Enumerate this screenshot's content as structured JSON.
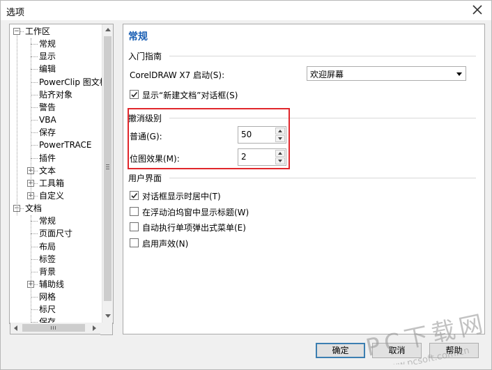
{
  "dialog": {
    "title": "选项"
  },
  "tree": {
    "items": [
      {
        "label": "工作区",
        "level": 0,
        "expander": "⊟"
      },
      {
        "label": "常规",
        "level": 1
      },
      {
        "label": "显示",
        "level": 1
      },
      {
        "label": "编辑",
        "level": 1
      },
      {
        "label": "PowerClip 图文框",
        "level": 1
      },
      {
        "label": "贴齐对象",
        "level": 1
      },
      {
        "label": "警告",
        "level": 1
      },
      {
        "label": "VBA",
        "level": 1
      },
      {
        "label": "保存",
        "level": 1
      },
      {
        "label": "PowerTRACE",
        "level": 1
      },
      {
        "label": "插件",
        "level": 1
      },
      {
        "label": "文本",
        "level": 1,
        "expander": "⊞"
      },
      {
        "label": "工具箱",
        "level": 1,
        "expander": "⊞"
      },
      {
        "label": "自定义",
        "level": 1,
        "expander": "⊞"
      },
      {
        "label": "文档",
        "level": 0,
        "expander": "⊟"
      },
      {
        "label": "常规",
        "level": 1
      },
      {
        "label": "页面尺寸",
        "level": 1
      },
      {
        "label": "布局",
        "level": 1
      },
      {
        "label": "标签",
        "level": 1
      },
      {
        "label": "背景",
        "level": 1
      },
      {
        "label": "辅助线",
        "level": 1,
        "expander": "⊞"
      },
      {
        "label": "网格",
        "level": 1
      },
      {
        "label": "标尺",
        "level": 1
      },
      {
        "label": "保存",
        "level": 1
      }
    ]
  },
  "panel": {
    "title": "常规",
    "section_start": "入门指南",
    "startup_label": "CorelDRAW X7 启动(S):",
    "startup_value": "欢迎屏幕",
    "show_new_doc_label": "显示“新建文档”对话框(S)",
    "show_new_doc_checked": true,
    "section_undo": "撤消级别",
    "normal_label": "普通(G):",
    "normal_value": "50",
    "bitmap_label": "位图效果(M):",
    "bitmap_value": "2",
    "section_ui": "用户界面",
    "ui_options": [
      {
        "label": "对话框显示时居中(T)",
        "checked": true
      },
      {
        "label": "在浮动泊坞窗中显示标题(W)",
        "checked": false
      },
      {
        "label": "自动执行单项弹出式菜单(E)",
        "checked": false
      },
      {
        "label": "启用声效(N)",
        "checked": false
      }
    ]
  },
  "buttons": {
    "ok": "确定",
    "cancel": "取消",
    "help": "帮助"
  },
  "watermark": {
    "text": "PC下载网",
    "url": "www.pcsoft.com.cn"
  },
  "colors": {
    "accent_title": "#1a5fb4",
    "highlight_box": "#e0262b",
    "watermark": "#9a9a9a"
  }
}
